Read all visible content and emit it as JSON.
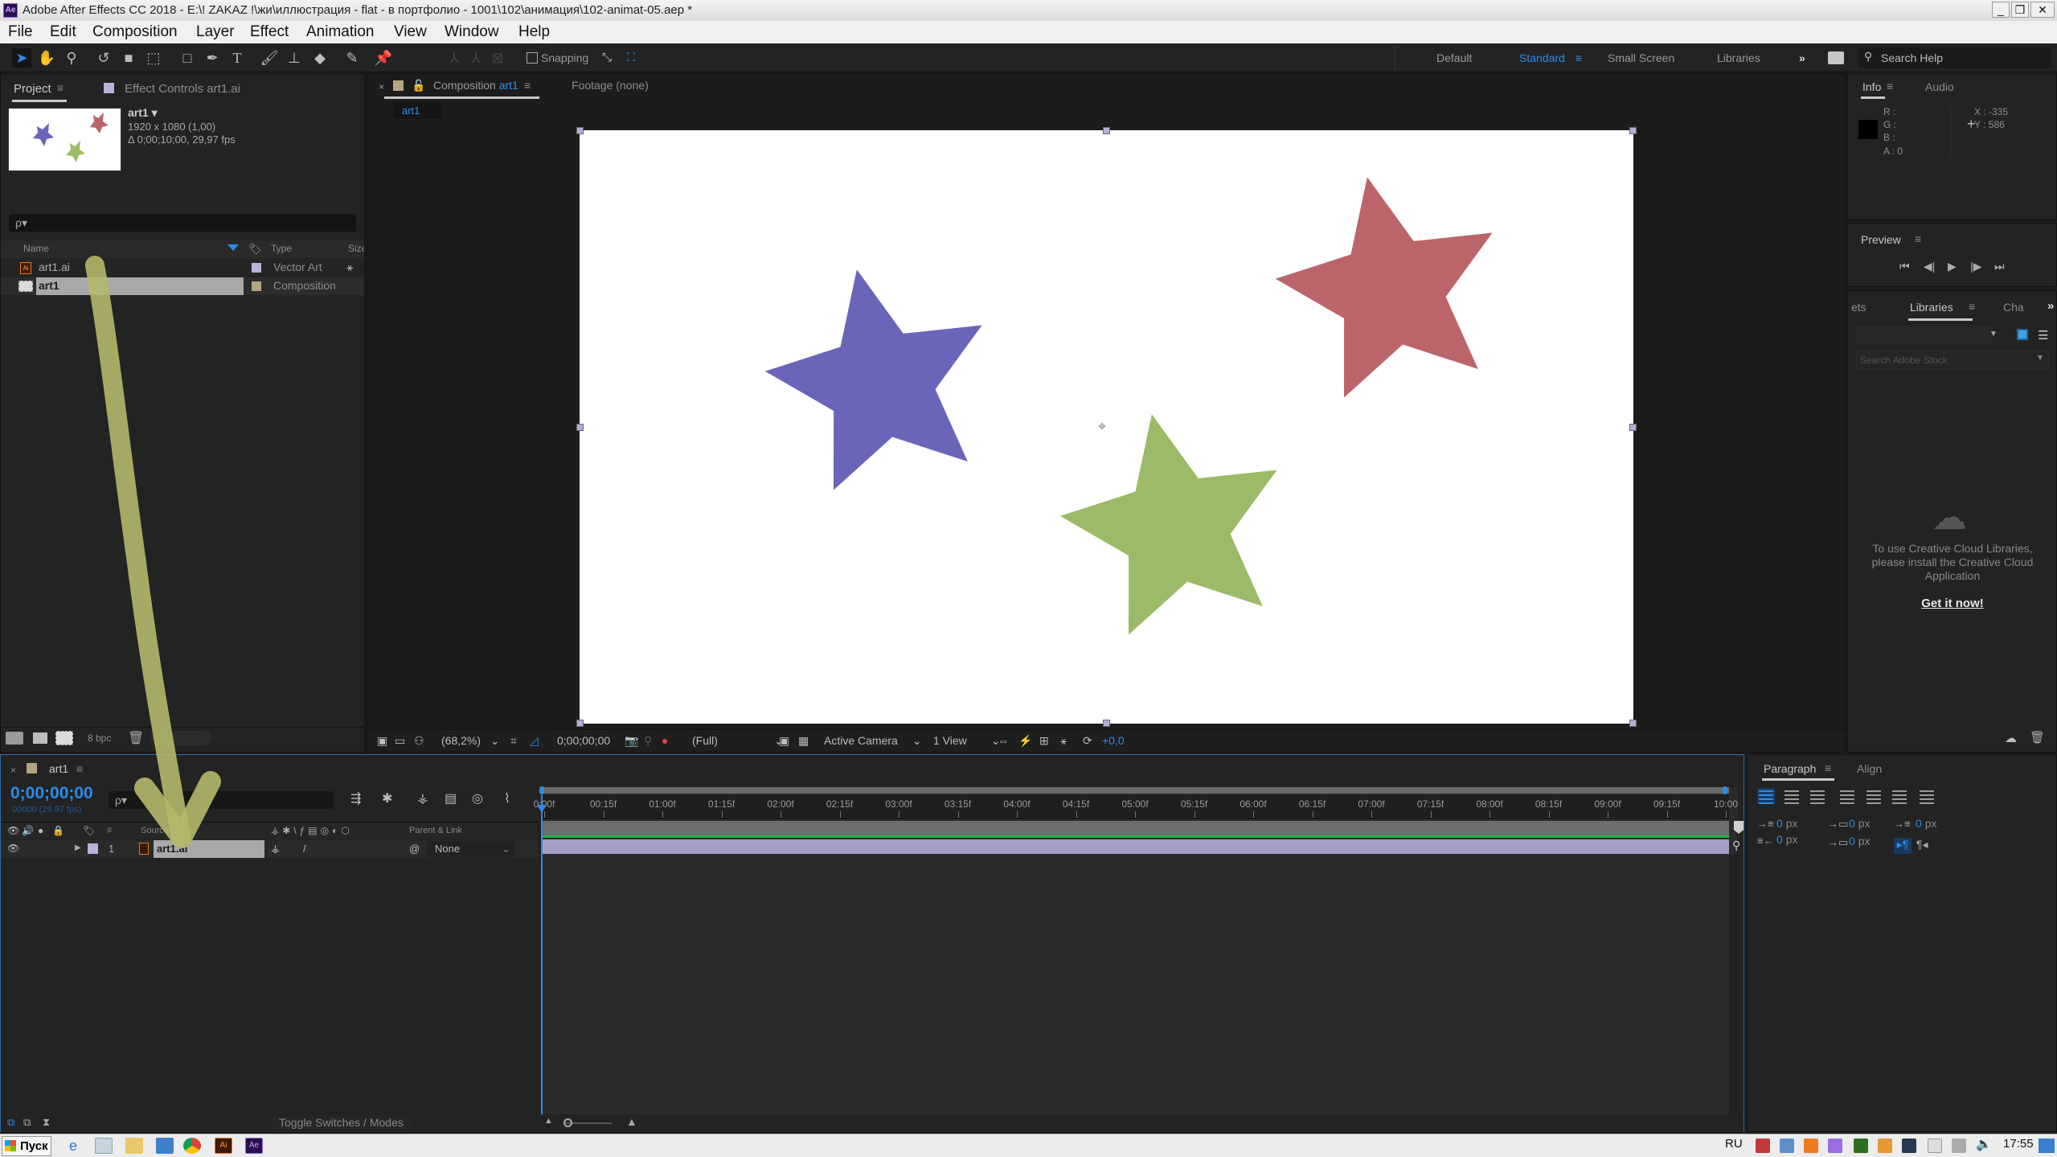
{
  "window": {
    "title": "Adobe After Effects CC 2018 - E:\\! ZAKAZ !\\жи\\иллюстрация - flat - в портфолио - 1001\\102\\анимация\\102-animat-05.aep *",
    "app_icon": "Ae",
    "controls": {
      "minimize": "_",
      "restore": "❐",
      "close": "✕"
    }
  },
  "menu": [
    "File",
    "Edit",
    "Composition",
    "Layer",
    "Effect",
    "Animation",
    "View",
    "Window",
    "Help"
  ],
  "toolbar": {
    "tools": [
      "selection-tool",
      "hand-tool",
      "zoom-tool",
      "rotation-tool",
      "camera-tool",
      "pan-behind-tool",
      "rectangle-tool",
      "pen-tool",
      "type-tool",
      "brush-tool",
      "clone-stamp-tool",
      "eraser-tool",
      "roto-brush-tool",
      "puppet-pin-tool"
    ],
    "snapping_label": "Snapping",
    "workspaces": [
      "Default",
      "Standard",
      "Small Screen",
      "Libraries"
    ],
    "active_workspace": "Standard",
    "more": "»",
    "search_placeholder": "Search Help"
  },
  "project_panel": {
    "tabs": [
      "Project",
      "Effect Controls art1.ai"
    ],
    "active_tab": "Project",
    "preview": {
      "name": "art1 ▾",
      "dimensions": "1920 x 1080 (1,00)",
      "duration": "Δ 0;00;10;00, 29,97 fps"
    },
    "search_placeholder": "ρ▾",
    "columns": [
      "Name",
      "Type",
      "Size"
    ],
    "items": [
      {
        "name": "art1.ai",
        "type": "Vector Art",
        "label_color": "#b7b3dc",
        "icon": "illustrator-file-icon"
      },
      {
        "name": "art1",
        "type": "Composition",
        "label_color": "#b3a67e",
        "icon": "composition-icon",
        "selected": true
      }
    ],
    "footer": {
      "bpc": "8 bpc"
    }
  },
  "composition_panel": {
    "tabs": [
      "Composition art1",
      "Footage (none)"
    ],
    "comp_tab_prefix": "Composition",
    "comp_tab_name": "art1",
    "footage_tab": "Footage (none)",
    "breadcrumb": "art1",
    "canvas": {
      "background": "#ffffff",
      "stars": [
        {
          "name": "blue-star",
          "color": "#6a65b8"
        },
        {
          "name": "red-star",
          "color": "#bb656b"
        },
        {
          "name": "green-star",
          "color": "#9bbb68"
        }
      ]
    },
    "footer": {
      "magnification": "(68,2%)",
      "timecode": "0;00;00;00",
      "resolution": "(Full)",
      "camera": "Active Camera",
      "views": "1 View",
      "exposure": "+0,0"
    }
  },
  "info_panel": {
    "tabs": [
      "Info",
      "Audio"
    ],
    "active_tab": "Info",
    "r": "R :",
    "g": "G :",
    "b": "B :",
    "a": "A :  0",
    "x": "X : -335",
    "y": "Y : 586"
  },
  "preview_panel": {
    "title": "Preview",
    "controls": [
      "first-frame",
      "previous-frame",
      "play",
      "next-frame",
      "last-frame"
    ]
  },
  "libraries_panel": {
    "tabs": [
      "ets",
      "Libraries",
      "Cha"
    ],
    "active_tab": "Libraries",
    "stock_search_placeholder": "Search Adobe Stock",
    "message": "To use Creative Cloud Libraries, please install the Creative Cloud Application",
    "link": "Get it now!"
  },
  "timeline_panel": {
    "tab": "art1",
    "timecode": "0;00;00;00",
    "frame_info": "00000 (29.97 fps)",
    "columns": {
      "hash": "#",
      "source_name": "Source Name",
      "parent": "Parent & Link"
    },
    "layers": [
      {
        "index": "1",
        "name": "art1.ai",
        "label_color": "#b7b3dc",
        "parent": "None"
      }
    ],
    "ruler": [
      "0:00f",
      "00:15f",
      "01:00f",
      "01:15f",
      "02:00f",
      "02:15f",
      "03:00f",
      "03:15f",
      "04:00f",
      "04:15f",
      "05:00f",
      "05:15f",
      "06:00f",
      "06:15f",
      "07:00f",
      "07:15f",
      "08:00f",
      "08:15f",
      "09:00f",
      "09:15f",
      "10:00"
    ],
    "toggle_label": "Toggle Switches / Modes",
    "layer_bar_color": "#a49fc4",
    "work_area_color": "#22b33a"
  },
  "paragraph_panel": {
    "tabs": [
      "Paragraph",
      "Align"
    ],
    "active_tab": "Paragraph",
    "fields": [
      {
        "value": "0",
        "unit": "px"
      },
      {
        "value": "0",
        "unit": "px"
      },
      {
        "value": "0",
        "unit": "px"
      },
      {
        "value": "0",
        "unit": "px"
      },
      {
        "value": "0",
        "unit": "px"
      }
    ]
  },
  "annotation": {
    "description": "hand-drawn yellow-green arrow pointing from art1.ai in project panel down to layer art1.ai in timeline",
    "color": "#b5b86a"
  },
  "taskbar": {
    "start_label": "Пуск",
    "apps": [
      "internet-explorer",
      "calculator",
      "file-explorer",
      "media-player",
      "chrome",
      "illustrator",
      "after-effects"
    ],
    "language": "RU",
    "clock": "17:55"
  }
}
